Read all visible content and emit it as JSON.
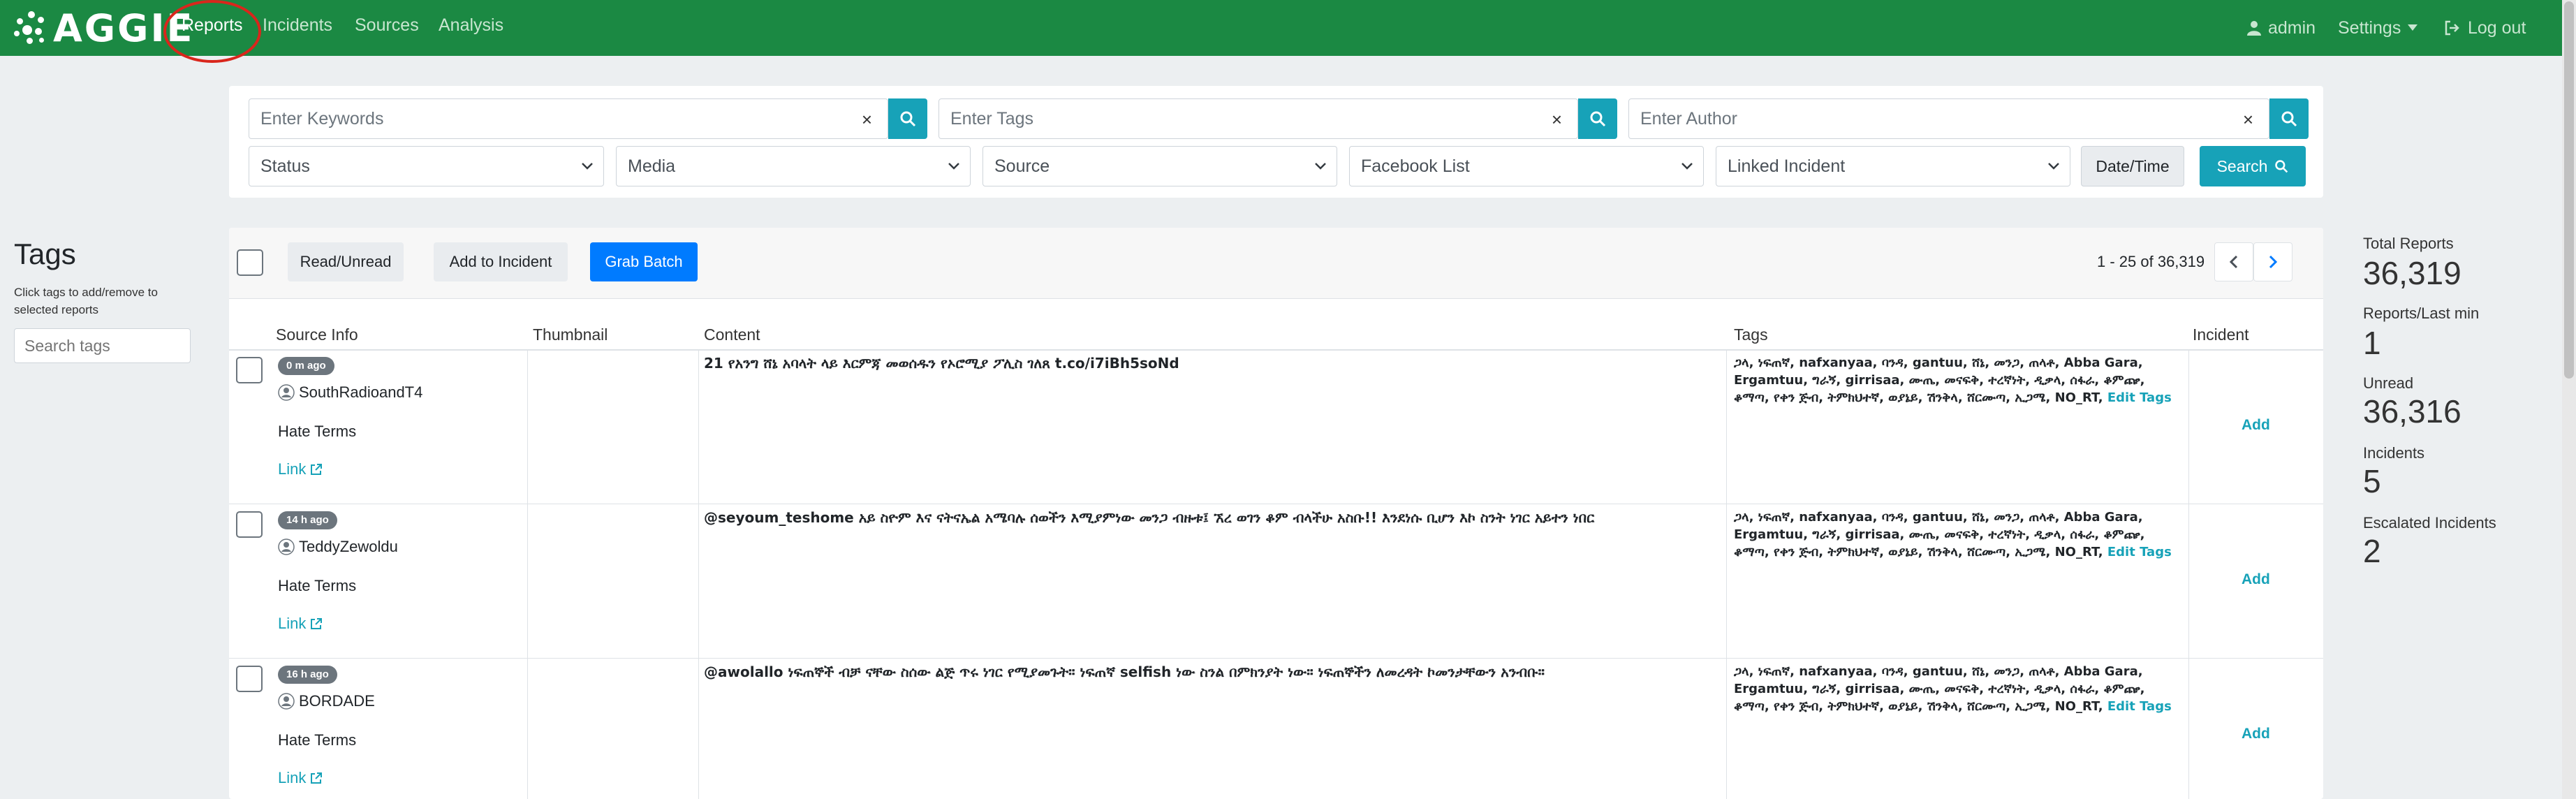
{
  "brand": {
    "name": "AGGIE"
  },
  "nav": {
    "reports": "Reports",
    "incidents": "Incidents",
    "sources": "Sources",
    "analysis": "Analysis",
    "user": "admin",
    "settings": "Settings",
    "logout": "Log out"
  },
  "filters": {
    "keywords_placeholder": "Enter Keywords",
    "tags_placeholder": "Enter Tags",
    "author_placeholder": "Enter Author",
    "clear": "×",
    "status": "Status",
    "media": "Media",
    "source": "Source",
    "facebook_list": "Facebook List",
    "linked_incident": "Linked Incident",
    "date_time": "Date/Time",
    "search": "Search"
  },
  "tags_sidebar": {
    "title": "Tags",
    "help": "Click tags to add/remove to selected reports",
    "search_placeholder": "Search tags"
  },
  "toolbar": {
    "read_unread": "Read/Unread",
    "add_to_incident": "Add to Incident",
    "grab_batch": "Grab Batch",
    "pagination": "1 - 25 of 36,319"
  },
  "columns": {
    "source_info": "Source Info",
    "thumbnail": "Thumbnail",
    "content": "Content",
    "tags": "Tags",
    "incident": "Incident"
  },
  "reports": [
    {
      "time": "0 m ago",
      "author": "SouthRadioandT4",
      "source_type": "Hate Terms",
      "link": "Link",
      "content": "21 የአንግ ሸኔ አባላት ላይ እርምጃ መወሰዱን የኦሮሚያ ፖሊስ ገለጸ t.co/i7iBh5soNd",
      "tags": "ጋላ, ነፍጠኛ, nafxanyaa, ባንዳ, gantuu, ሸኔ, መንጋ, ጠላቶ, Abba Gara, Ergamtuu, ግራኝ, girrisaa, ሙጤ, መናፍቅ, ተረኛነት, ዲቃላ, ሰፋራ, ቆምጬ, ቆማጣ, የቀን ጅብ, ትምክህተኛ, ወያኔይ, ሽንቅላ, ሸርሙጣ, ኢጋሜ, NO_RT,",
      "edit_tags": "Edit Tags",
      "incident_action": "Add"
    },
    {
      "time": "14 h ago",
      "author": "TeddyZewoldu",
      "source_type": "Hate Terms",
      "link": "Link",
      "content": "@seyoum_teshome አይ ስዮም እና ናትናኤል አሜባሉ ሰወችን እሚያምነው መንጋ ብዙቱ፤ ኧረ ወገን ቆም ብላችሁ አስቡ!! እንደነሱ ቢሆን እኮ ስንት ነገር አይተን ነበር",
      "tags": "ጋላ, ነፍጠኛ, nafxanyaa, ባንዳ, gantuu, ሸኔ, መንጋ, ጠላቶ, Abba Gara, Ergamtuu, ግራኝ, girrisaa, ሙጤ, መናፍቅ, ተረኛነት, ዲቃላ, ሰፋራ, ቆምጬ, ቆማጣ, የቀን ጅብ, ትምክህተኛ, ወያኔይ, ሽንቅላ, ሸርሙጣ, ኢጋሜ, NO_RT,",
      "edit_tags": "Edit Tags",
      "incident_action": "Add"
    },
    {
      "time": "16 h ago",
      "author": "BORDADE",
      "source_type": "Hate Terms",
      "link": "Link",
      "content": "@awolallo ነፍጠኞች ብቻ ናቸው ስሰው ልጅ ጥሩ ነገር የሚያመጉት። ነፍጠኛ selfish ነው ስንል በምክንያት ነው። ነፍጠኞችን ለመረዳት ኮመንታቸውን አንብቡ።",
      "tags": "ጋላ, ነፍጠኛ, nafxanyaa, ባንዳ, gantuu, ሸኔ, መንጋ, ጠላቶ, Abba Gara, Ergamtuu, ግራኝ, girrisaa, ሙጤ, መናፍቅ, ተረኛነት, ዲቃላ, ሰፋራ, ቆምጬ, ቆማጣ, የቀን ጅብ, ትምክህተኛ, ወያኔይ, ሽንቅላ, ሸርሙጣ, ኢጋሜ, NO_RT,",
      "edit_tags": "Edit Tags",
      "incident_action": "Add"
    }
  ],
  "stats": {
    "total_reports_label": "Total Reports",
    "total_reports": "36,319",
    "per_min_label": "Reports/Last min",
    "per_min": "1",
    "unread_label": "Unread",
    "unread": "36,316",
    "incidents_label": "Incidents",
    "incidents": "5",
    "escalated_label": "Escalated Incidents",
    "escalated": "2"
  },
  "colors": {
    "navbar": "#1b8943",
    "accent_teal": "#17a2b8",
    "primary_blue": "#007bff",
    "highlight_circle": "#d9261c"
  }
}
